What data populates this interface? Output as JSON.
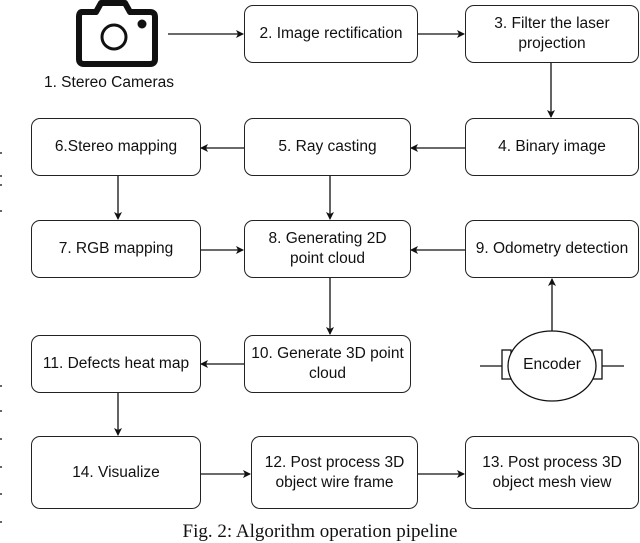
{
  "figure": {
    "caption": "Fig. 2: Algorithm operation pipeline",
    "camera": {
      "icon": "camera-icon",
      "label": "1. Stereo Cameras"
    },
    "encoder": {
      "label": "Encoder"
    },
    "steps": {
      "s2": "2. Image rectification",
      "s3": "3. Filter the laser projection",
      "s4": "4. Binary image",
      "s5": "5. Ray casting",
      "s6": "6.Stereo mapping",
      "s7": "7. RGB mapping",
      "s8": "8. Generating 2D point cloud",
      "s9": "9. Odometry detection",
      "s10": "10. Generate 3D point cloud",
      "s11": "11. Defects heat map",
      "s12": "12. Post process 3D object wire frame",
      "s13": "13. Post process 3D object mesh view",
      "s14": "14. Visualize"
    },
    "edges": [
      [
        "s1",
        "s2"
      ],
      [
        "s2",
        "s3"
      ],
      [
        "s3",
        "s4"
      ],
      [
        "s4",
        "s5"
      ],
      [
        "s5",
        "s6"
      ],
      [
        "s6",
        "s7"
      ],
      [
        "s5",
        "s8"
      ],
      [
        "s7",
        "s8"
      ],
      [
        "s9",
        "s8"
      ],
      [
        "encoder",
        "s9"
      ],
      [
        "s8",
        "s10"
      ],
      [
        "s10",
        "s11"
      ],
      [
        "s11",
        "s14"
      ],
      [
        "s14",
        "s12"
      ],
      [
        "s12",
        "s13"
      ]
    ]
  }
}
